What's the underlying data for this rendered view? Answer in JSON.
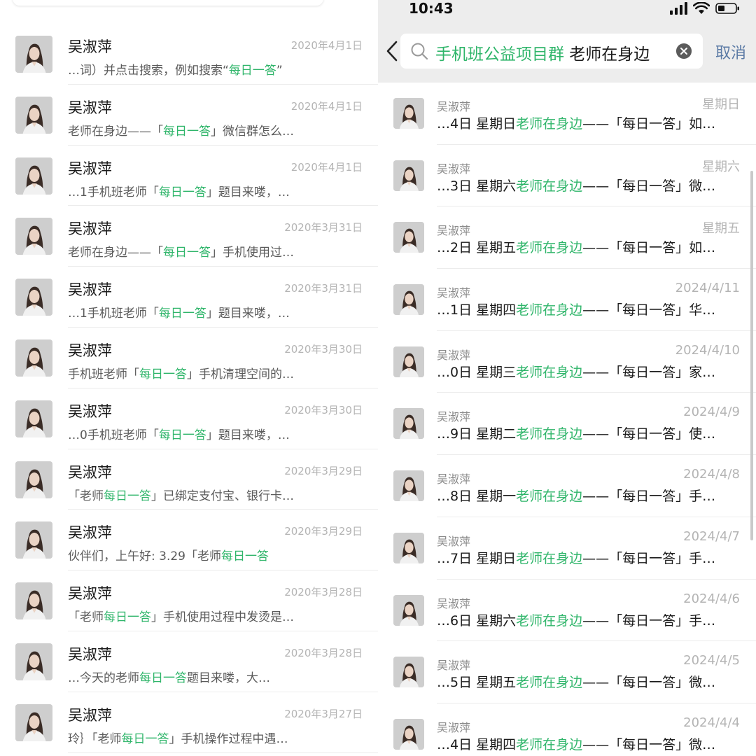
{
  "colors": {
    "highlight": "#2fb56a",
    "cancel": "#5b7aa5",
    "timestamp": "#b4b4b4",
    "header_bg": "#ededed"
  },
  "left": {
    "messages": [
      {
        "sender": "吴淑萍",
        "time": "2020年4月1日",
        "pre": "…词）并点击搜索，例如搜索“",
        "kw": "每日一答",
        "post": "”"
      },
      {
        "sender": "吴淑萍",
        "time": "2020年4月1日",
        "pre": "老师在身边——「",
        "kw": "每日一答",
        "post": "」微信群怎么…"
      },
      {
        "sender": "吴淑萍",
        "time": "2020年4月1日",
        "pre": "…1手机班老师「",
        "kw": "每日一答",
        "post": "」题目来喽，…"
      },
      {
        "sender": "吴淑萍",
        "time": "2020年3月31日",
        "pre": "老师在身边——「",
        "kw": "每日一答",
        "post": "」手机使用过…"
      },
      {
        "sender": "吴淑萍",
        "time": "2020年3月31日",
        "pre": "…1手机班老师「",
        "kw": "每日一答",
        "post": "」题目来喽，…"
      },
      {
        "sender": "吴淑萍",
        "time": "2020年3月30日",
        "pre": "手机班老师「",
        "kw": "每日一答",
        "post": "」手机清理空间的…"
      },
      {
        "sender": "吴淑萍",
        "time": "2020年3月30日",
        "pre": "…0手机班老师「",
        "kw": "每日一答",
        "post": "」题目来喽，…"
      },
      {
        "sender": "吴淑萍",
        "time": "2020年3月29日",
        "pre": "「老师",
        "kw": "每日一答",
        "post": "」已绑定支付宝、银行卡…"
      },
      {
        "sender": "吴淑萍",
        "time": "2020年3月29日",
        "pre": "伙伴们，上午好:        3.29「老师",
        "kw": "每日一答",
        "post": ""
      },
      {
        "sender": "吴淑萍",
        "time": "2020年3月28日",
        "pre": "「老师",
        "kw": "每日一答",
        "post": "」手机使用过程中发烫是…"
      },
      {
        "sender": "吴淑萍",
        "time": "2020年3月28日",
        "pre": "…今天的老师",
        "kw": "每日一答",
        "post": "题目来喽，大…"
      },
      {
        "sender": "吴淑萍",
        "time": "2020年3月27日",
        "pre": "玲｝「老师",
        "kw": "每日一答",
        "post": "」手机操作过程中遇…"
      }
    ]
  },
  "right": {
    "status": {
      "time": "10:43"
    },
    "search": {
      "keyword": "手机班公益项目群",
      "query": " 老师在身边"
    },
    "cancel_label": "取消",
    "messages": [
      {
        "sender": "吴淑萍",
        "time": "星期日",
        "pre": "…4日  星期日",
        "kw": "老师在身边",
        "post": "——「每日一答」如…"
      },
      {
        "sender": "吴淑萍",
        "time": "星期六",
        "pre": "…3日  星期六",
        "kw": "老师在身边",
        "post": "——「每日一答」微…"
      },
      {
        "sender": "吴淑萍",
        "time": "星期五",
        "pre": "…2日  星期五",
        "kw": "老师在身边",
        "post": "——「每日一答」如…"
      },
      {
        "sender": "吴淑萍",
        "time": "2024/4/11",
        "pre": "…1日  星期四",
        "kw": "老师在身边",
        "post": "——「每日一答」华…"
      },
      {
        "sender": "吴淑萍",
        "time": "2024/4/10",
        "pre": "…0日  星期三",
        "kw": "老师在身边",
        "post": "——「每日一答」家…"
      },
      {
        "sender": "吴淑萍",
        "time": "2024/4/9",
        "pre": "…9日  星期二",
        "kw": "老师在身边",
        "post": "——「每日一答」使…"
      },
      {
        "sender": "吴淑萍",
        "time": "2024/4/8",
        "pre": "…8日  星期一",
        "kw": "老师在身边",
        "post": "——「每日一答」手…"
      },
      {
        "sender": "吴淑萍",
        "time": "2024/4/7",
        "pre": "…7日  星期日",
        "kw": "老师在身边",
        "post": "——「每日一答」手…"
      },
      {
        "sender": "吴淑萍",
        "time": "2024/4/6",
        "pre": "…6日  星期六",
        "kw": "老师在身边",
        "post": "——「每日一答」手…"
      },
      {
        "sender": "吴淑萍",
        "time": "2024/4/5",
        "pre": "…5日  星期五",
        "kw": "老师在身边",
        "post": "——「每日一答」微…"
      },
      {
        "sender": "吴淑萍",
        "time": "2024/4/4",
        "pre": "…4日  星期四",
        "kw": "老师在身边",
        "post": "——「每日一答」微…"
      }
    ]
  }
}
